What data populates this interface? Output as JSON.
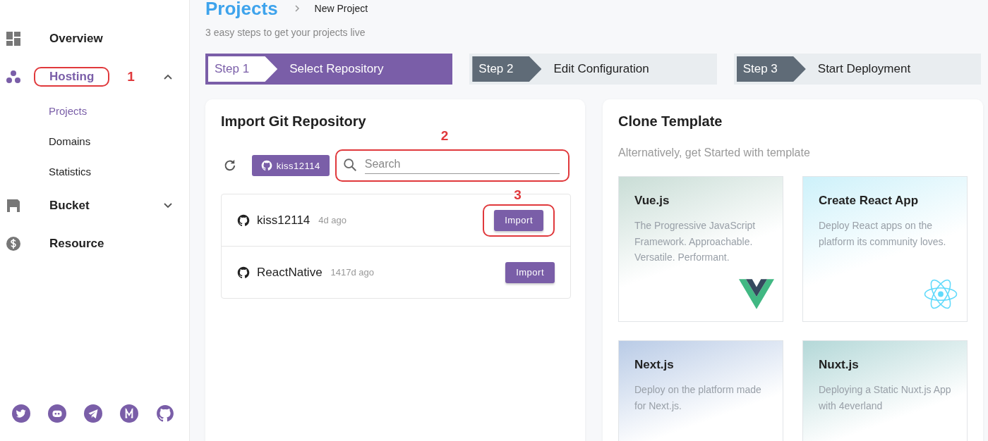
{
  "sidebar": {
    "items": [
      {
        "label": "Overview",
        "selected": false
      },
      {
        "label": "Hosting",
        "selected": true,
        "expanded": true,
        "annotation": "1",
        "children": [
          {
            "label": "Projects",
            "selected": true
          },
          {
            "label": "Domains",
            "selected": false
          },
          {
            "label": "Statistics",
            "selected": false
          }
        ]
      },
      {
        "label": "Bucket",
        "selected": false,
        "expanded": false
      },
      {
        "label": "Resource",
        "selected": false
      }
    ]
  },
  "header": {
    "title": "Projects",
    "breadcrumb": "New Project",
    "subtitle": "3 easy steps to get your projects live"
  },
  "steps": [
    {
      "label": "Step 1",
      "title": "Select Repository",
      "selected": true
    },
    {
      "label": "Step 2",
      "title": "Edit Configuration",
      "selected": false
    },
    {
      "label": "Step 3",
      "title": "Start Deployment",
      "selected": false
    }
  ],
  "import_panel": {
    "title": "Import Git Repository",
    "account": "kiss12114",
    "search": {
      "placeholder": "Search",
      "annotation": "2"
    },
    "repos": [
      {
        "name": "kiss12114",
        "age": "4d ago",
        "button": "Import",
        "annotation": "3"
      },
      {
        "name": "ReactNative",
        "age": "1417d ago",
        "button": "Import"
      }
    ]
  },
  "clone_panel": {
    "title": "Clone Template",
    "subtitle": "Alternatively, get Started with template",
    "templates": [
      {
        "title": "Vue.js",
        "description": "The Progressive JavaScript Framework. Approachable. Versatile. Performant.",
        "color": "#c9ddd6"
      },
      {
        "title": "Create React App",
        "description": "Deploy React apps on the platform its community loves.",
        "color": "#cdf1fa"
      },
      {
        "title": "Next.js",
        "description": "Deploy on the platform made for Next.js.",
        "color": "#b9cbe6"
      },
      {
        "title": "Nuxt.js",
        "description": "Deploying a Static Nuxt.js App with 4everland",
        "color": "#b4d8d8"
      }
    ]
  }
}
